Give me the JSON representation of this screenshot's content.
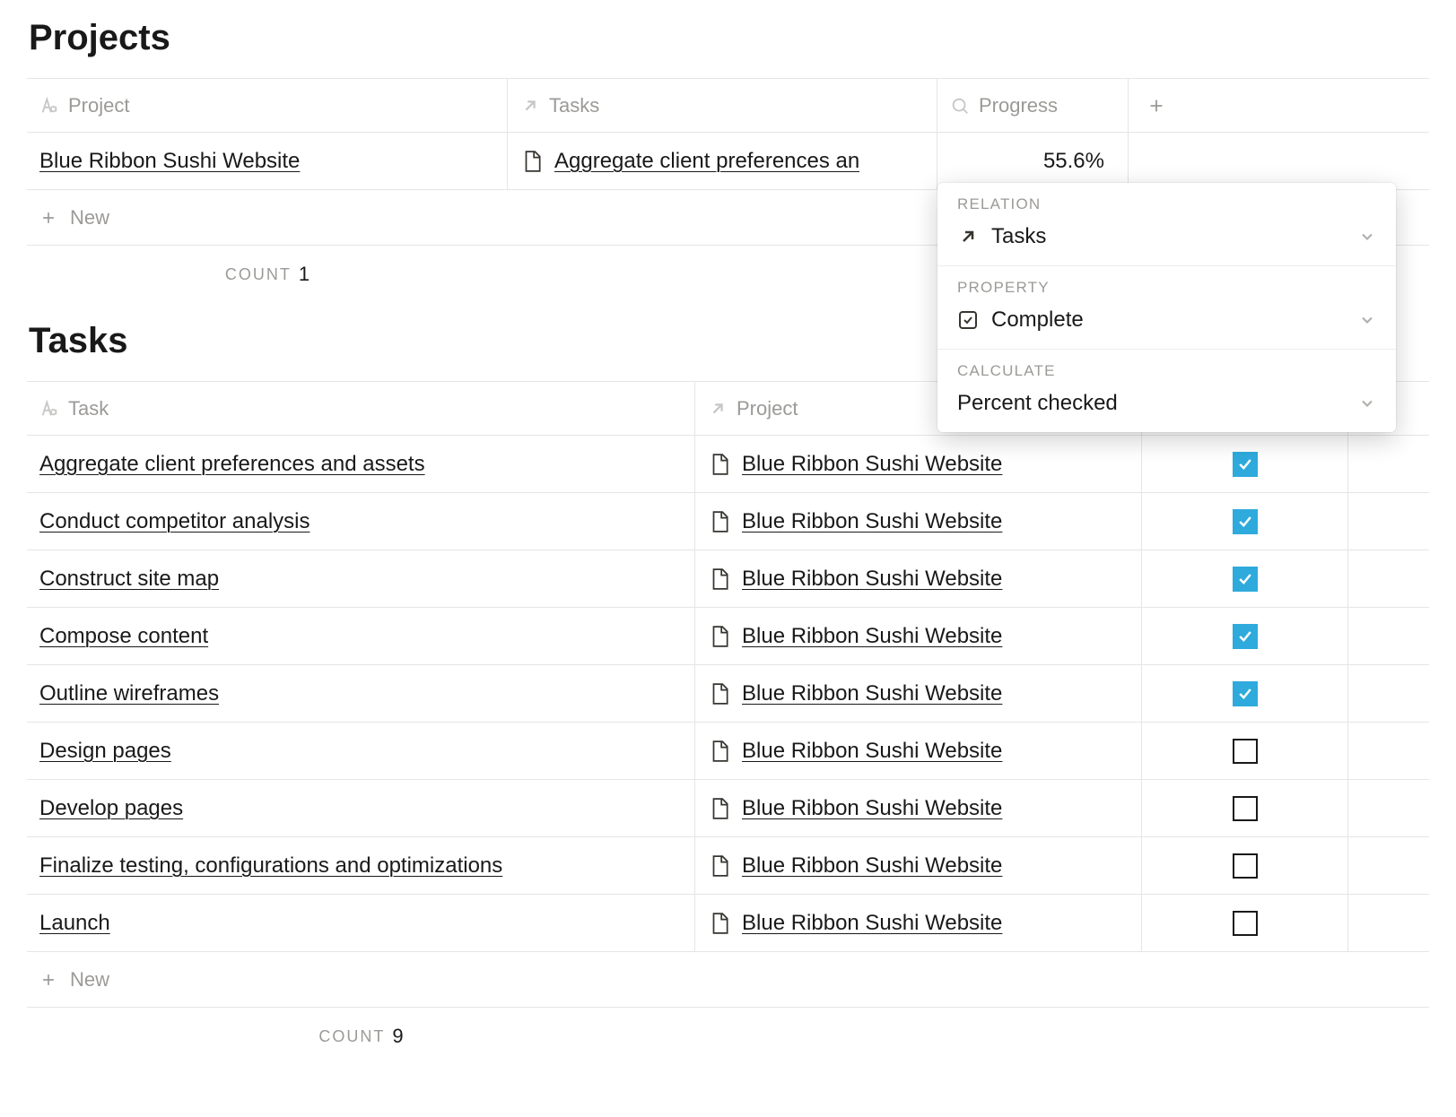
{
  "projects": {
    "heading": "Projects",
    "columns": {
      "name": "Project",
      "tasks": "Tasks",
      "progress": "Progress"
    },
    "rows": [
      {
        "name": "Blue Ribbon Sushi Website",
        "tasks_label": "Aggregate client preferences an",
        "progress": "55.6%"
      }
    ],
    "new_label": "New",
    "count_label": "COUNT",
    "count_value": "1"
  },
  "tasks": {
    "heading": "Tasks",
    "columns": {
      "name": "Task",
      "project": "Project"
    },
    "rows": [
      {
        "name": "Aggregate client preferences and assets",
        "project": "Blue Ribbon Sushi Website",
        "complete": true
      },
      {
        "name": "Conduct competitor analysis",
        "project": "Blue Ribbon Sushi Website",
        "complete": true
      },
      {
        "name": "Construct site map",
        "project": "Blue Ribbon Sushi Website",
        "complete": true
      },
      {
        "name": "Compose content",
        "project": "Blue Ribbon Sushi Website",
        "complete": true
      },
      {
        "name": "Outline wireframes",
        "project": "Blue Ribbon Sushi Website",
        "complete": true
      },
      {
        "name": "Design pages",
        "project": "Blue Ribbon Sushi Website",
        "complete": false
      },
      {
        "name": "Develop pages",
        "project": "Blue Ribbon Sushi Website",
        "complete": false
      },
      {
        "name": "Finalize testing, configurations and optimizations",
        "project": "Blue Ribbon Sushi Website",
        "complete": false
      },
      {
        "name": "Launch",
        "project": "Blue Ribbon Sushi Website",
        "complete": false
      }
    ],
    "new_label": "New",
    "count_label": "COUNT",
    "count_value": "9"
  },
  "panel": {
    "relation_label": "RELATION",
    "relation_value": "Tasks",
    "property_label": "PROPERTY",
    "property_value": "Complete",
    "calculate_label": "CALCULATE",
    "calculate_value": "Percent checked"
  }
}
